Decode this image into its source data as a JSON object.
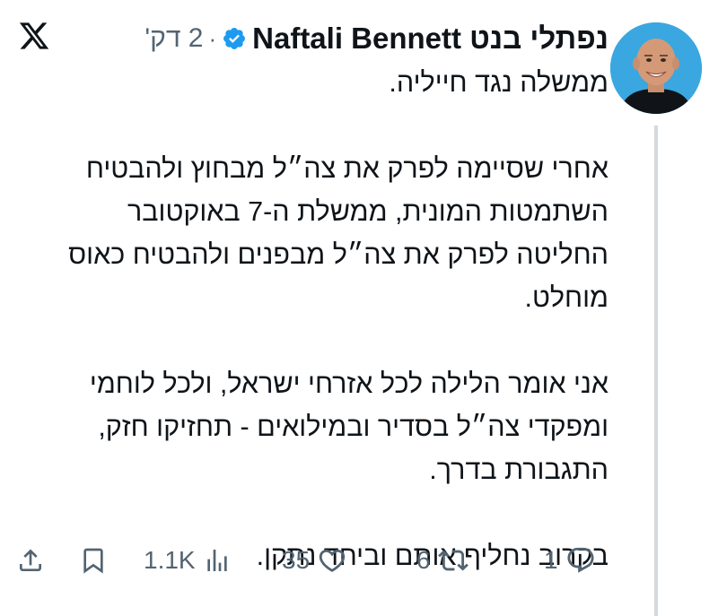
{
  "header": {
    "display_name": "נפתלי בנט Naftali Bennett",
    "timestamp": "2 דק'",
    "separator": "·",
    "verified": true,
    "platform_icon": "x-logo-icon"
  },
  "body": {
    "paragraphs": [
      [
        "ממשלה נגד חייליה."
      ],
      [
        "אחרי שסיימה לפרק את צה״ל מבחוץ ולהבטיח",
        "השתמטות המונית, ממשלת ה-7 באוקטובר",
        "החליטה לפרק את צה״ל מבפנים ולהבטיח כאוס",
        "מוחלט."
      ],
      [
        "אני אומר הלילה לכל אזרחי ישראל, ולכל לוחמי",
        "ומפקדי צה״ל בסדיר ובמילואים - תחזיקו חזק,",
        "התגבורת בדרך."
      ],
      [
        "בקרוב נחליף אותם וביחד נתקן."
      ]
    ]
  },
  "actions": {
    "replies": "1",
    "reposts": "6",
    "likes": "35",
    "views": "1.1K"
  },
  "colors": {
    "text": "#0f1419",
    "muted": "#536471",
    "verified": "#1d9bf0"
  }
}
